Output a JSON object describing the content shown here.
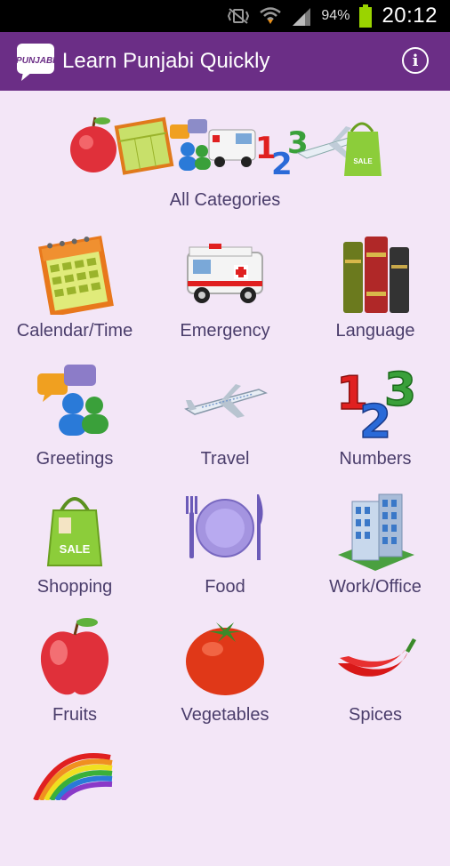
{
  "status_bar": {
    "battery_percent": "94%",
    "time": "20:12"
  },
  "app_bar": {
    "logo_text": "PUNJABI",
    "title": "Learn Punjabi Quickly",
    "info_icon": "info-icon"
  },
  "all_categories": {
    "label": "All Categories"
  },
  "categories": [
    {
      "label": "Calendar/Time",
      "icon": "calendar-icon"
    },
    {
      "label": "Emergency",
      "icon": "ambulance-icon"
    },
    {
      "label": "Language",
      "icon": "books-icon"
    },
    {
      "label": "Greetings",
      "icon": "chat-people-icon"
    },
    {
      "label": "Travel",
      "icon": "airplane-icon"
    },
    {
      "label": "Numbers",
      "icon": "numbers-icon"
    },
    {
      "label": "Shopping",
      "icon": "shopping-bag-icon"
    },
    {
      "label": "Food",
      "icon": "plate-icon"
    },
    {
      "label": "Work/Office",
      "icon": "office-building-icon"
    },
    {
      "label": "Fruits",
      "icon": "apple-icon"
    },
    {
      "label": "Vegetables",
      "icon": "tomato-icon"
    },
    {
      "label": "Spices",
      "icon": "chili-icon"
    },
    {
      "label": "",
      "icon": "rainbow-icon"
    }
  ]
}
